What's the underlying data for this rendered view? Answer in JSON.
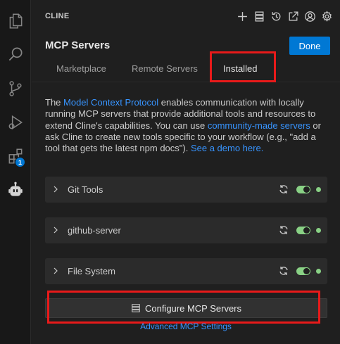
{
  "activity_bar": {
    "items": [
      {
        "icon": "files-icon"
      },
      {
        "icon": "search-icon"
      },
      {
        "icon": "source-control-icon"
      },
      {
        "icon": "run-debug-icon"
      },
      {
        "icon": "extensions-icon",
        "badge": "1"
      },
      {
        "icon": "cline-robot-icon"
      }
    ]
  },
  "header": {
    "title": "CLINE",
    "icons": [
      "plus-icon",
      "server-stack-icon",
      "history-icon",
      "popout-icon",
      "account-icon",
      "settings-icon"
    ]
  },
  "panel": {
    "title": "MCP Servers",
    "done_label": "Done"
  },
  "tabs": [
    {
      "label": "Marketplace",
      "active": false
    },
    {
      "label": "Remote Servers",
      "active": false
    },
    {
      "label": "Installed",
      "active": true
    }
  ],
  "description": {
    "part1": "The ",
    "link1": "Model Context Protocol",
    "part2": " enables communication with locally running MCP servers that provide additional tools and resources to extend Cline's capabilities. You can use ",
    "link2": "community-made servers",
    "part3": " or ask Cline to create new tools specific to your workflow (e.g., \"add a tool that gets the latest npm docs\"). ",
    "link3": "See a demo here."
  },
  "servers": [
    {
      "name": "Git Tools",
      "enabled": true,
      "status": "connected"
    },
    {
      "name": "github-server",
      "enabled": true,
      "status": "connected"
    },
    {
      "name": "File System",
      "enabled": true,
      "status": "connected"
    }
  ],
  "configure_label": "Configure MCP Servers",
  "advanced_label": "Advanced MCP Settings",
  "colors": {
    "accent": "#0078d4",
    "link": "#3794ff",
    "status_green": "#89d185",
    "highlight_red": "#e81a1a"
  }
}
